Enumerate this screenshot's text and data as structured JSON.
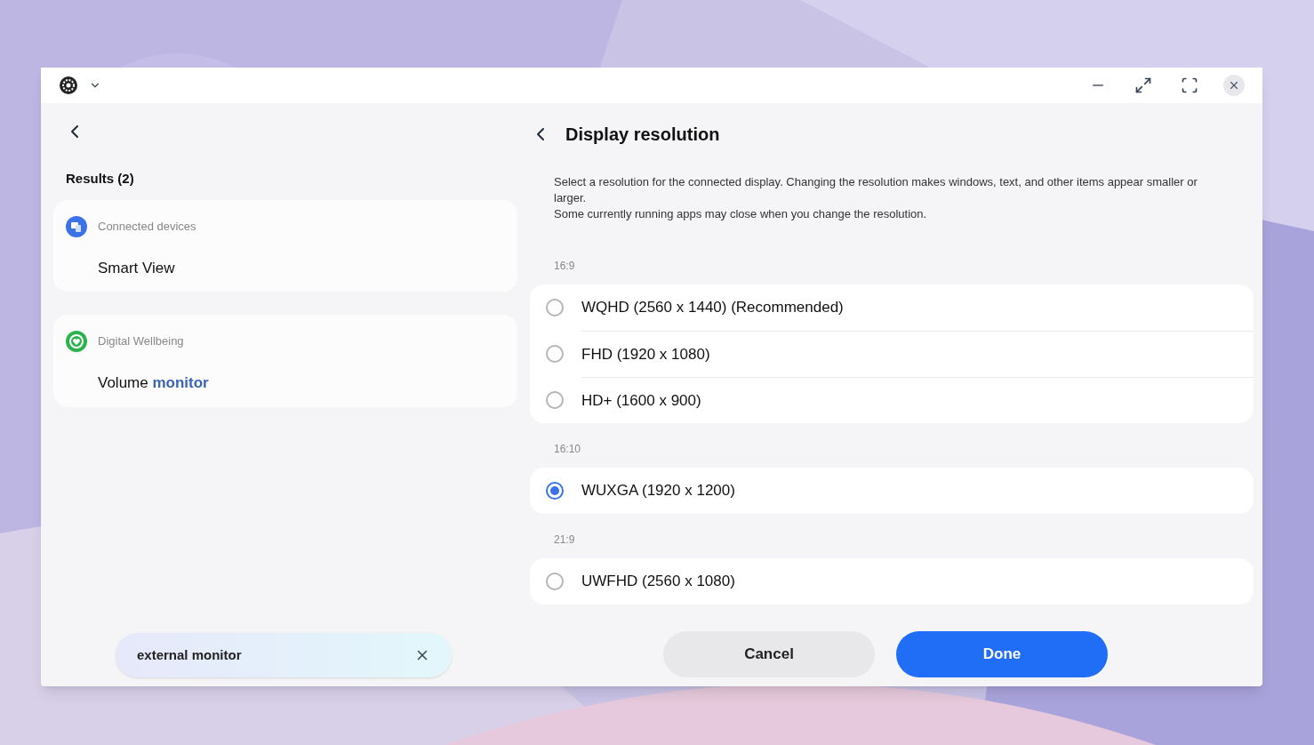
{
  "left_panel": {
    "heading": "Results (2)",
    "results": [
      {
        "category": "Connected devices",
        "kind": "devices",
        "title": "Smart View"
      },
      {
        "category": "Digital Wellbeing",
        "kind": "wellbeing",
        "title": "Volume",
        "highlight": "monitor"
      }
    ]
  },
  "search": {
    "value": "external monitor"
  },
  "right_panel": {
    "title": "Display resolution",
    "description": [
      "Select a resolution for the connected display. Changing the resolution makes windows, text, and other items appear smaller or larger.",
      "Some currently running apps may close when you change the resolution."
    ],
    "groups": [
      {
        "label": "16:9",
        "options": [
          {
            "label": "WQHD (2560 x 1440) (Recommended)",
            "selected": false
          },
          {
            "label": "FHD (1920 x 1080)",
            "selected": false
          },
          {
            "label": "HD+ (1600 x 900)",
            "selected": false
          }
        ]
      },
      {
        "label": "16:10",
        "options": [
          {
            "label": "WUXGA (1920 x 1200)",
            "selected": true
          }
        ]
      },
      {
        "label": "21:9",
        "options": [
          {
            "label": "UWFHD (2560 x 1080)",
            "selected": false
          }
        ]
      }
    ]
  },
  "buttons": [
    {
      "label": "Cancel",
      "kind": "secondary"
    },
    {
      "label": "Done",
      "kind": "primary"
    }
  ]
}
